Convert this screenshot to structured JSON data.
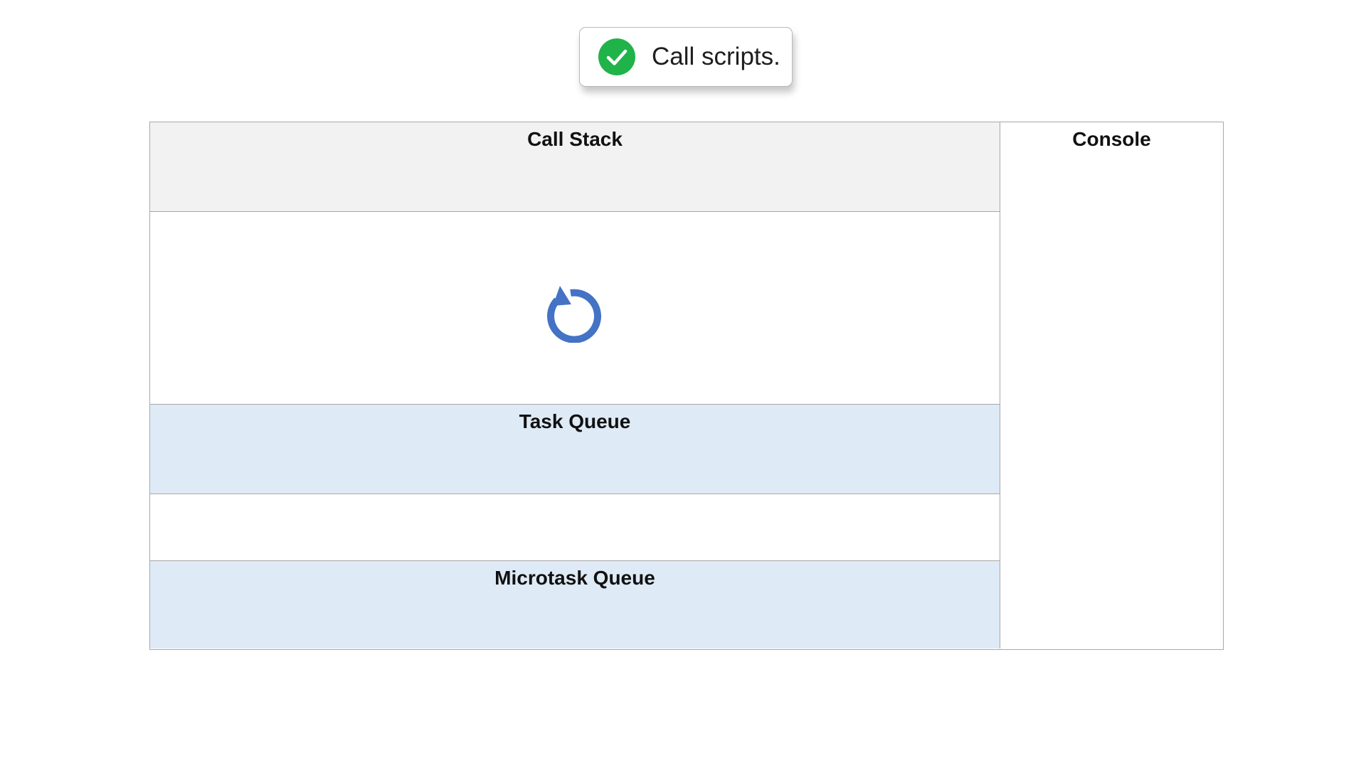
{
  "toast": {
    "message": "Call scripts.",
    "icon": "check-circle-icon",
    "icon_color": "#20b34a"
  },
  "diagram": {
    "call_stack": {
      "title": "Call Stack",
      "background": "#f2f2f2"
    },
    "stack_area": {
      "icon": "refresh-icon",
      "icon_color": "#4472c4"
    },
    "task_queue": {
      "title": "Task Queue",
      "background": "#deeaf6"
    },
    "microtask_queue": {
      "title": "Microtask Queue",
      "background": "#deeaf6"
    },
    "console": {
      "title": "Console"
    }
  }
}
